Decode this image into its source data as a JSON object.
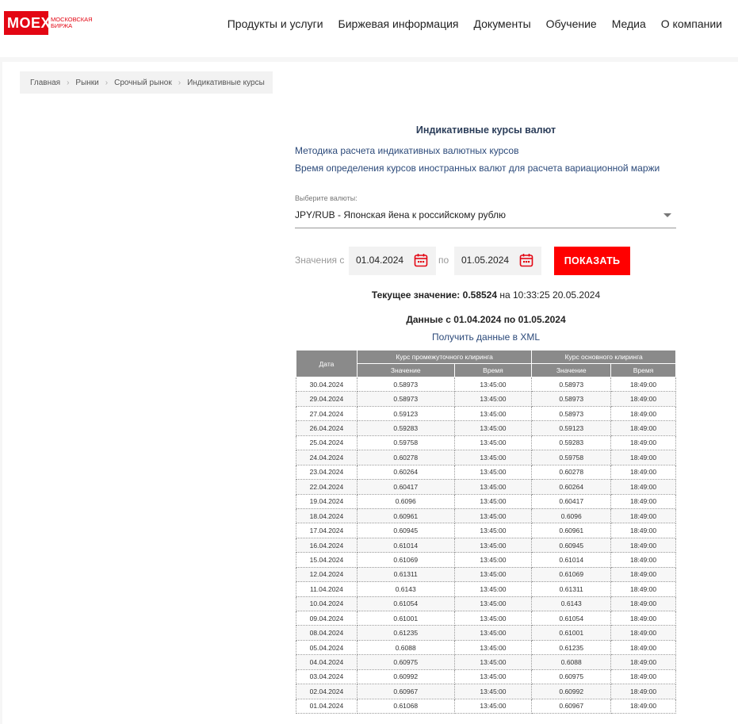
{
  "brand": {
    "logo_text": "MOEX",
    "logo_sub": "Московская биржа"
  },
  "nav": [
    "Продукты и услуги",
    "Биржевая информация",
    "Документы",
    "Обучение",
    "Медиа",
    "О компании"
  ],
  "breadcrumb": [
    "Главная",
    "Рынки",
    "Срочный рынок",
    "Индикативные курсы"
  ],
  "page": {
    "title": "Индикативные курсы валют",
    "link_method": "Методика расчета индикативных валютных курсов",
    "link_time": "Время определения курсов иностранных валют для расчета вариационной маржи"
  },
  "currency_select": {
    "label": "Выберите валюты:",
    "value": "JPY/RUB - Японская йена к российскому рублю"
  },
  "date_filter": {
    "from_label": "Значения с",
    "from_value": "01.04.2024",
    "to_label": "по",
    "to_value": "01.05.2024",
    "show_button": "ПОКАЗАТЬ"
  },
  "current_value": {
    "label": "Текущее значение:",
    "value": "0.58524",
    "at": "на 10:33:25 20.05.2024"
  },
  "range_title": "Данные с 01.04.2024 по 01.05.2024",
  "xml_link": "Получить данные в XML",
  "table": {
    "col_date": "Дата",
    "group_intermediate": "Курс промежуточного клиринга",
    "group_main": "Курс основного клиринга",
    "col_value": "Значение",
    "col_time": "Время",
    "rows": [
      [
        "30.04.2024",
        "0.58973",
        "13:45:00",
        "0.58973",
        "18:49:00"
      ],
      [
        "29.04.2024",
        "0.58973",
        "13:45:00",
        "0.58973",
        "18:49:00"
      ],
      [
        "27.04.2024",
        "0.59123",
        "13:45:00",
        "0.58973",
        "18:49:00"
      ],
      [
        "26.04.2024",
        "0.59283",
        "13:45:00",
        "0.59123",
        "18:49:00"
      ],
      [
        "25.04.2024",
        "0.59758",
        "13:45:00",
        "0.59283",
        "18:49:00"
      ],
      [
        "24.04.2024",
        "0.60278",
        "13:45:00",
        "0.59758",
        "18:49:00"
      ],
      [
        "23.04.2024",
        "0.60264",
        "13:45:00",
        "0.60278",
        "18:49:00"
      ],
      [
        "22.04.2024",
        "0.60417",
        "13:45:00",
        "0.60264",
        "18:49:00"
      ],
      [
        "19.04.2024",
        "0.6096",
        "13:45:00",
        "0.60417",
        "18:49:00"
      ],
      [
        "18.04.2024",
        "0.60961",
        "13:45:00",
        "0.6096",
        "18:49:00"
      ],
      [
        "17.04.2024",
        "0.60945",
        "13:45:00",
        "0.60961",
        "18:49:00"
      ],
      [
        "16.04.2024",
        "0.61014",
        "13:45:00",
        "0.60945",
        "18:49:00"
      ],
      [
        "15.04.2024",
        "0.61069",
        "13:45:00",
        "0.61014",
        "18:49:00"
      ],
      [
        "12.04.2024",
        "0.61311",
        "13:45:00",
        "0.61069",
        "18:49:00"
      ],
      [
        "11.04.2024",
        "0.6143",
        "13:45:00",
        "0.61311",
        "18:49:00"
      ],
      [
        "10.04.2024",
        "0.61054",
        "13:45:00",
        "0.6143",
        "18:49:00"
      ],
      [
        "09.04.2024",
        "0.61001",
        "13:45:00",
        "0.61054",
        "18:49:00"
      ],
      [
        "08.04.2024",
        "0.61235",
        "13:45:00",
        "0.61001",
        "18:49:00"
      ],
      [
        "05.04.2024",
        "0.6088",
        "13:45:00",
        "0.61235",
        "18:49:00"
      ],
      [
        "04.04.2024",
        "0.60975",
        "13:45:00",
        "0.6088",
        "18:49:00"
      ],
      [
        "03.04.2024",
        "0.60992",
        "13:45:00",
        "0.60975",
        "18:49:00"
      ],
      [
        "02.04.2024",
        "0.60967",
        "13:45:00",
        "0.60992",
        "18:49:00"
      ],
      [
        "01.04.2024",
        "0.61068",
        "13:45:00",
        "0.60967",
        "18:49:00"
      ]
    ]
  },
  "colors": {
    "brand_red": "#e30613",
    "button_red": "#ff0000",
    "link_blue": "#2c4a7a",
    "table_header": "#8a8a8a"
  }
}
